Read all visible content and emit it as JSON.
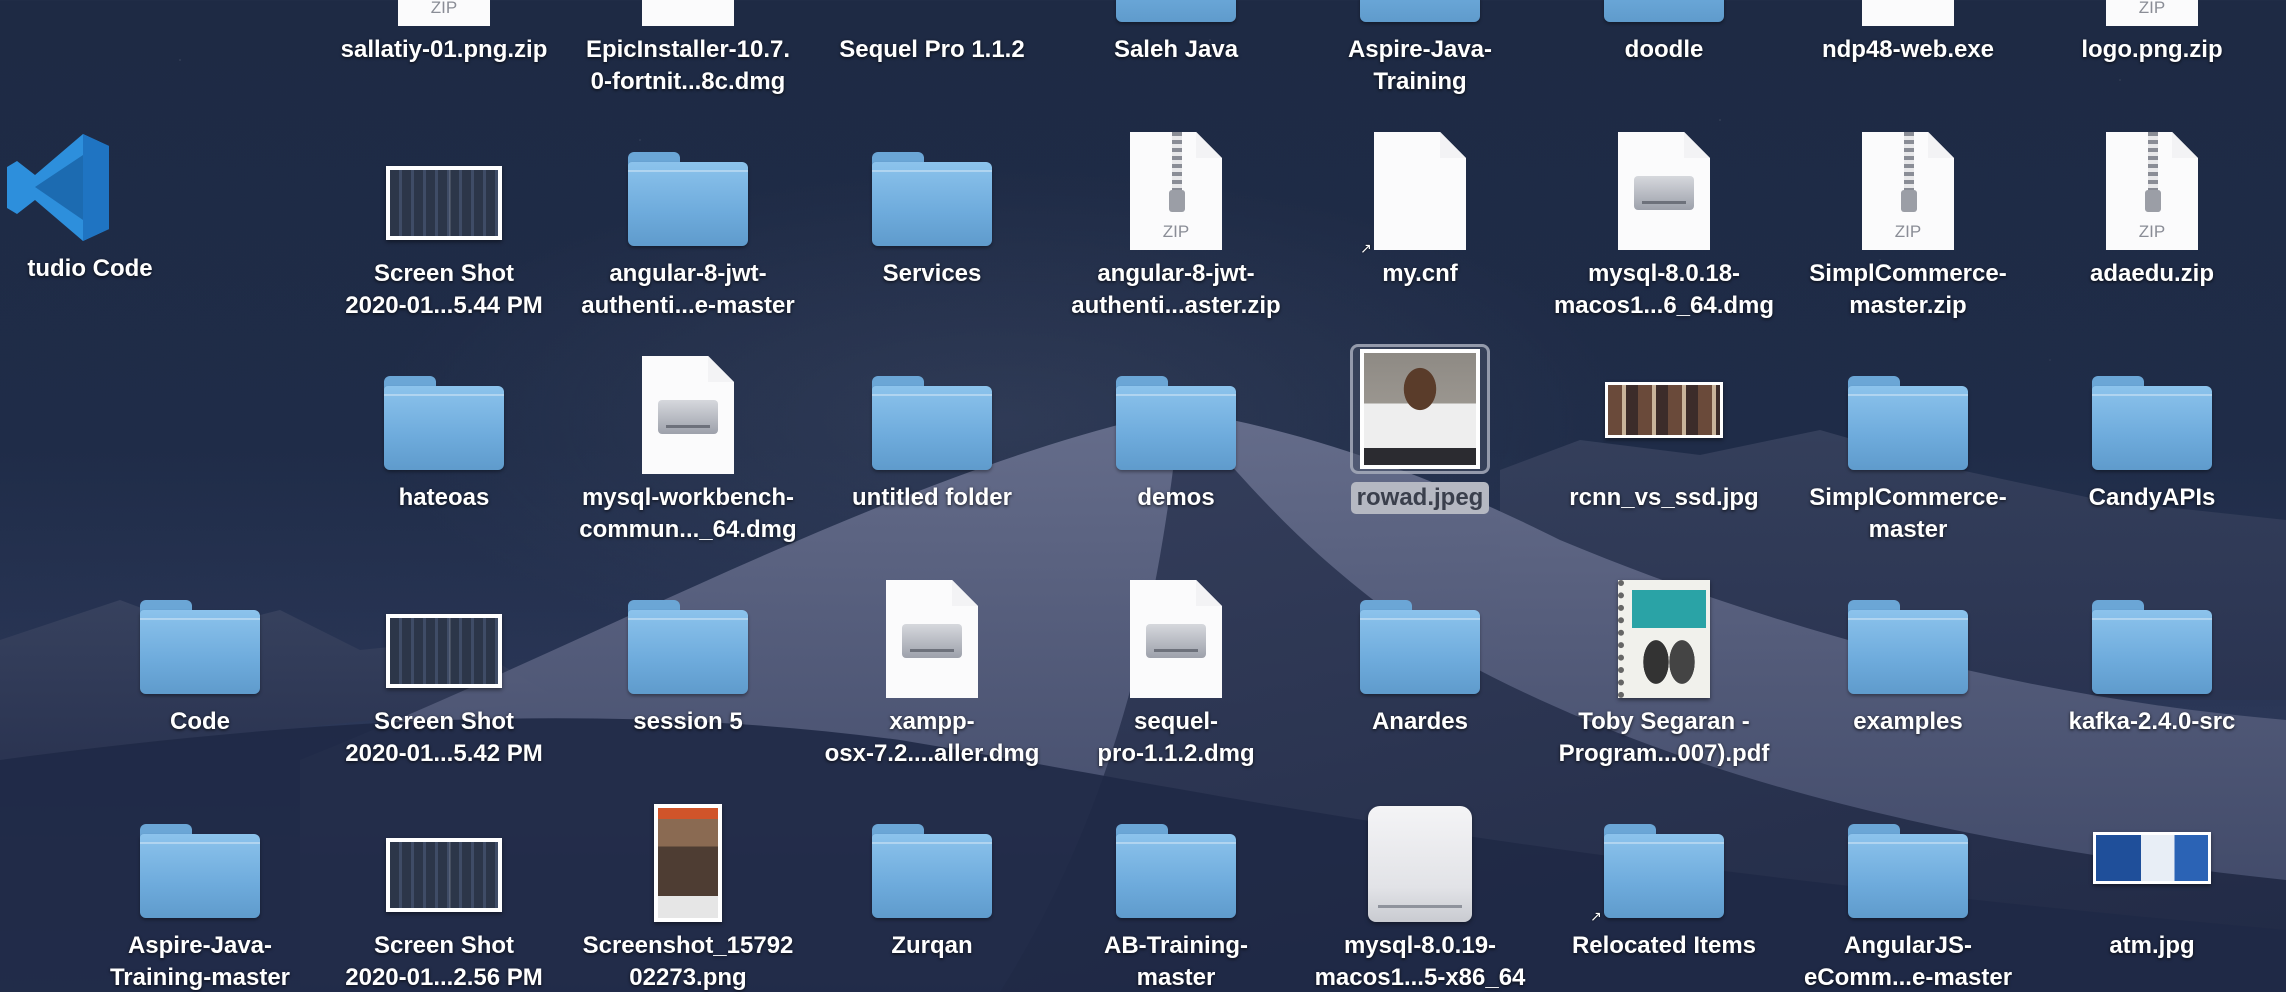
{
  "desktop": {
    "vscode_label": "tudio Code",
    "items": [
      {
        "label": "sallatiy-01.png.zip",
        "kind": "zip",
        "col": 0,
        "row": 0
      },
      {
        "label": "EpicInstaller-10.7.\n0-fortnit...8c.dmg",
        "kind": "dmg",
        "col": 1,
        "row": 0
      },
      {
        "label": "Sequel Pro 1.1.2",
        "kind": "drive-flat",
        "col": 2,
        "row": 0
      },
      {
        "label": "Saleh Java",
        "kind": "folder",
        "col": 3,
        "row": 0
      },
      {
        "label": "Aspire-Java-\nTraining",
        "kind": "folder",
        "col": 4,
        "row": 0
      },
      {
        "label": "doodle",
        "kind": "folder",
        "col": 5,
        "row": 0
      },
      {
        "label": "ndp48-web.exe",
        "kind": "doc",
        "col": 6,
        "row": 0
      },
      {
        "label": "logo.png.zip",
        "kind": "zip",
        "col": 7,
        "row": 0
      },
      {
        "label": "Screen Shot\n2020-01...5.44 PM",
        "kind": "shot",
        "col": 0,
        "row": 1
      },
      {
        "label": "angular-8-jwt-\nauthenti...e-master",
        "kind": "folder",
        "col": 1,
        "row": 1
      },
      {
        "label": "Services",
        "kind": "folder",
        "col": 2,
        "row": 1
      },
      {
        "label": "angular-8-jwt-\nauthenti...aster.zip",
        "kind": "zip",
        "col": 3,
        "row": 1
      },
      {
        "label": "my.cnf",
        "kind": "doc-alias",
        "col": 4,
        "row": 1
      },
      {
        "label": "mysql-8.0.18-\nmacos1...6_64.dmg",
        "kind": "dmg",
        "col": 5,
        "row": 1
      },
      {
        "label": "SimplCommerce-\nmaster.zip",
        "kind": "zip",
        "col": 6,
        "row": 1
      },
      {
        "label": "adaedu.zip",
        "kind": "zip",
        "col": 7,
        "row": 1
      },
      {
        "label": "hateoas",
        "kind": "folder",
        "col": 0,
        "row": 2
      },
      {
        "label": "mysql-workbench-\ncommun..._64.dmg",
        "kind": "dmg",
        "col": 1,
        "row": 2
      },
      {
        "label": "untitled folder",
        "kind": "folder",
        "col": 2,
        "row": 2
      },
      {
        "label": "demos",
        "kind": "folder",
        "col": 3,
        "row": 2
      },
      {
        "label": "rowad.jpeg",
        "kind": "photo",
        "col": 4,
        "row": 2,
        "selected": true
      },
      {
        "label": "rcnn_vs_ssd.jpg",
        "kind": "wide-photo",
        "col": 5,
        "row": 2
      },
      {
        "label": "SimplCommerce-\nmaster",
        "kind": "folder",
        "col": 6,
        "row": 2
      },
      {
        "label": "CandyAPIs",
        "kind": "folder",
        "col": 7,
        "row": 2
      },
      {
        "label": "Code",
        "kind": "folder",
        "col": -1,
        "row": 3
      },
      {
        "label": "Screen Shot\n2020-01...5.42 PM",
        "kind": "shot",
        "col": 0,
        "row": 3
      },
      {
        "label": "session 5",
        "kind": "folder",
        "col": 1,
        "row": 3
      },
      {
        "label": "xampp-\nosx-7.2....aller.dmg",
        "kind": "dmg",
        "col": 2,
        "row": 3
      },
      {
        "label": "sequel-\npro-1.1.2.dmg",
        "kind": "dmg",
        "col": 3,
        "row": 3
      },
      {
        "label": "Anardes",
        "kind": "folder",
        "col": 4,
        "row": 3
      },
      {
        "label": "Toby Segaran -\nProgram...007).pdf",
        "kind": "book",
        "col": 5,
        "row": 3
      },
      {
        "label": "examples",
        "kind": "folder",
        "col": 6,
        "row": 3
      },
      {
        "label": "kafka-2.4.0-src",
        "kind": "folder",
        "col": 7,
        "row": 3
      },
      {
        "label": "Aspire-Java-\nTraining-master",
        "kind": "folder",
        "col": -1,
        "row": 4
      },
      {
        "label": "Screen Shot\n2020-01...2.56 PM",
        "kind": "shot",
        "col": 0,
        "row": 4
      },
      {
        "label": "Screenshot_15792\n02273.png",
        "kind": "phone",
        "col": 1,
        "row": 4
      },
      {
        "label": "Zurqan",
        "kind": "folder",
        "col": 2,
        "row": 4
      },
      {
        "label": "AB-Training-\nmaster",
        "kind": "folder",
        "col": 3,
        "row": 4
      },
      {
        "label": "mysql-8.0.19-\nmacos1...5-x86_64",
        "kind": "drive",
        "col": 4,
        "row": 4
      },
      {
        "label": "Relocated Items",
        "kind": "folder-alias",
        "col": 5,
        "row": 4
      },
      {
        "label": "AngularJS-\neComm...e-master",
        "kind": "folder",
        "col": 6,
        "row": 4
      },
      {
        "label": "atm.jpg",
        "kind": "atm",
        "col": 7,
        "row": 4
      }
    ]
  },
  "icons": {
    "zip_text": "ZIP"
  }
}
